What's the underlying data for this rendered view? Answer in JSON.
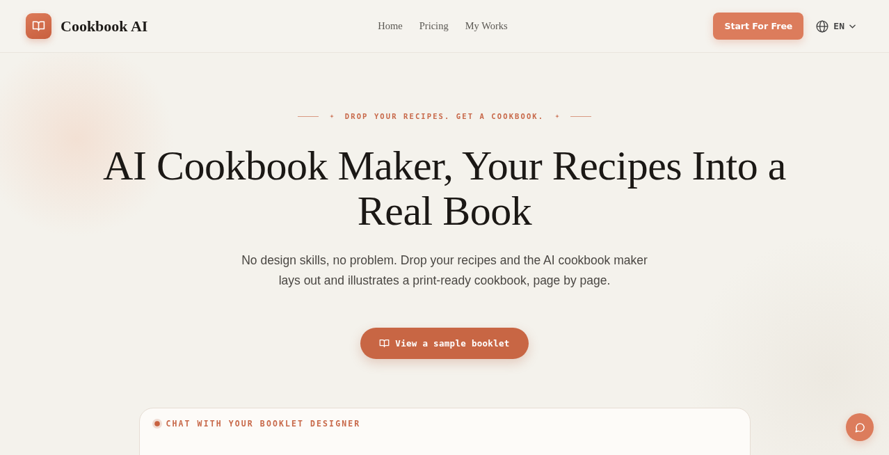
{
  "header": {
    "brand": "Cookbook AI",
    "nav": [
      {
        "label": "Home"
      },
      {
        "label": "Pricing"
      },
      {
        "label": "My Works"
      }
    ],
    "cta": "Start For Free",
    "language": "EN"
  },
  "hero": {
    "eyebrow": "DROP YOUR RECIPES. GET A COOKBOOK.",
    "title": "AI Cookbook Maker, Your Recipes Into a Real Book",
    "subtitle": "No design skills, no problem. Drop your recipes and the AI cookbook maker lays out and illustrates a print-ready cookbook, page by page.",
    "button": "View a sample booklet"
  },
  "chat_panel": {
    "label": "CHAT WITH YOUR BOOKLET DESIGNER"
  }
}
